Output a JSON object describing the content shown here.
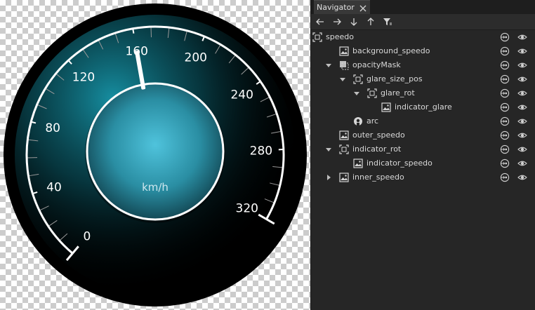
{
  "canvas": {
    "background": "checkerboard",
    "gauge": {
      "type": "speedometer",
      "scale_min": 0,
      "scale_max": 320,
      "major_labels": [
        "0",
        "40",
        "80",
        "120",
        "160",
        "200",
        "240",
        "280",
        "320"
      ],
      "unit": "km/h",
      "needle_value": 160,
      "colors": {
        "outer": "#000000",
        "ring": "#ffffff",
        "inner_center": "#4fc3dc",
        "glow": "#1aa7bd"
      }
    }
  },
  "navigator": {
    "title": "Navigator",
    "toolbar": [
      {
        "icon": "arrow-left-icon"
      },
      {
        "icon": "arrow-right-icon"
      },
      {
        "icon": "arrow-down-icon"
      },
      {
        "icon": "arrow-up-icon"
      },
      {
        "icon": "filter-icon"
      }
    ],
    "tree": [
      {
        "label": "speedo",
        "type": "item",
        "expander": "none"
      },
      {
        "label": "background_speedo",
        "type": "image",
        "expander": "none"
      },
      {
        "label": "opacityMask",
        "type": "mask",
        "expander": "expanded"
      },
      {
        "label": "glare_size_pos",
        "type": "item",
        "expander": "expanded"
      },
      {
        "label": "glare_rot",
        "type": "item",
        "expander": "expanded"
      },
      {
        "label": "indicator_glare",
        "type": "image",
        "expander": "none"
      },
      {
        "label": "arc",
        "type": "shape",
        "expander": "none"
      },
      {
        "label": "outer_speedo",
        "type": "image",
        "expander": "none"
      },
      {
        "label": "indicator_rot",
        "type": "item",
        "expander": "expanded"
      },
      {
        "label": "indicator_speedo",
        "type": "image",
        "expander": "none"
      },
      {
        "label": "inner_speedo",
        "type": "image",
        "expander": "collapsed"
      }
    ]
  }
}
